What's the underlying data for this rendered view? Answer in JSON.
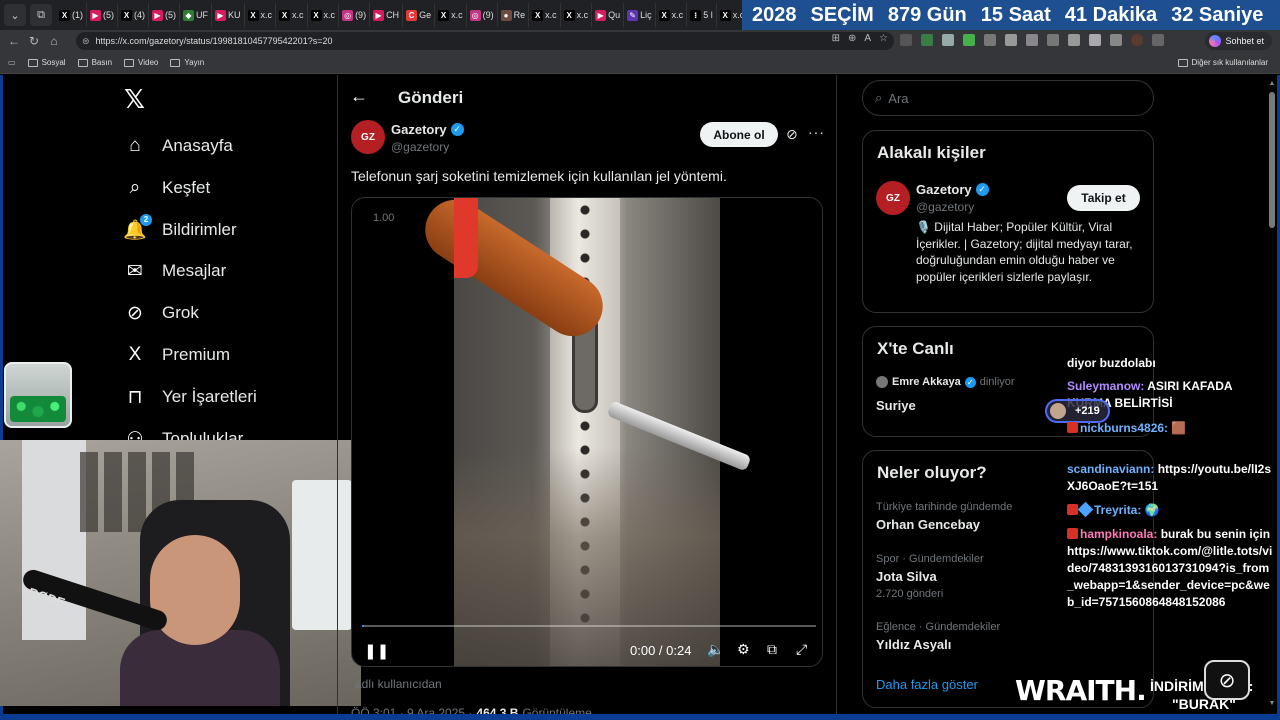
{
  "browser": {
    "tabs": [
      {
        "label": "(1)",
        "color": "#000000",
        "glyph": "X"
      },
      {
        "label": "(5)",
        "color": "#d81b60",
        "glyph": "▶"
      },
      {
        "label": "(4)",
        "color": "#000000",
        "glyph": "X"
      },
      {
        "label": "(5)",
        "color": "#d81b60",
        "glyph": "▶"
      },
      {
        "label": "UF",
        "color": "#2e7d32",
        "glyph": "◆"
      },
      {
        "label": "KU",
        "color": "#d81b60",
        "glyph": "▶"
      },
      {
        "label": "x.c",
        "color": "#000000",
        "glyph": "X"
      },
      {
        "label": "x.c",
        "color": "#000000",
        "glyph": "X"
      },
      {
        "label": "x.c",
        "color": "#000000",
        "glyph": "X"
      },
      {
        "label": "(9)",
        "color": "#c13584",
        "glyph": "◎"
      },
      {
        "label": "CH",
        "color": "#d81b60",
        "glyph": "▶"
      },
      {
        "label": "Ge",
        "color": "#e53935",
        "glyph": "C"
      },
      {
        "label": "x.c",
        "color": "#000000",
        "glyph": "X"
      },
      {
        "label": "(9)",
        "color": "#c13584",
        "glyph": "◎"
      },
      {
        "label": "Re",
        "color": "#6d4c41",
        "glyph": "●"
      },
      {
        "label": "x.c",
        "color": "#000000",
        "glyph": "X"
      },
      {
        "label": "x.c",
        "color": "#000000",
        "glyph": "X"
      },
      {
        "label": "Qu",
        "color": "#d81b60",
        "glyph": "▶"
      },
      {
        "label": "Liç",
        "color": "#5e35b1",
        "glyph": "✎"
      },
      {
        "label": "x.c",
        "color": "#000000",
        "glyph": "X"
      },
      {
        "label": "5 l",
        "color": "#000000",
        "glyph": "⁝"
      },
      {
        "label": "x.c",
        "color": "#000000",
        "glyph": "X"
      },
      {
        "label": "W",
        "color": "#1e88e5",
        "glyph": "∞"
      }
    ],
    "countdown": {
      "year": "2028",
      "label": "SEÇİM",
      "days": "879 Gün",
      "hours": "15 Saat",
      "minutes": "41 Dakika",
      "seconds": "32 Saniye"
    },
    "url": "https://x.com/gazetory/status/1998181045779542201?s=20",
    "chat_button": "Sohbet et",
    "bookmarks": [
      "Sosyal",
      "Basın",
      "Video",
      "Yayın"
    ],
    "bookmarks_other": "Diğer sık kullanılanlar"
  },
  "sidebar": {
    "items": [
      {
        "label": "Anasayfa",
        "icon": "home-icon",
        "glyph": "⌂"
      },
      {
        "label": "Keşfet",
        "icon": "search-icon",
        "glyph": "⌕"
      },
      {
        "label": "Bildirimler",
        "icon": "bell-icon",
        "glyph": "🔔",
        "badge": "2"
      },
      {
        "label": "Mesajlar",
        "icon": "mail-icon",
        "glyph": "✉"
      },
      {
        "label": "Grok",
        "icon": "grok-icon",
        "glyph": "⊘"
      },
      {
        "label": "Premium",
        "icon": "x-premium-icon",
        "glyph": "X"
      },
      {
        "label": "Yer İşaretleri",
        "icon": "bookmark-icon",
        "glyph": "⊓"
      },
      {
        "label": "Topluluklar",
        "icon": "communities-icon",
        "glyph": "⚇"
      }
    ]
  },
  "main": {
    "title": "Gönderi",
    "author": {
      "name": "Gazetory",
      "handle": "@gazetory",
      "avatar_text": "GZ"
    },
    "subscribe_label": "Abone ol",
    "tweet_text": "Telefonun şarj soketini temizlemek için kullanılan jel yöntemi.",
    "video": {
      "speed": "1.00",
      "time": "0:00 / 0:24",
      "progress": 0.005
    },
    "attribution": "adlı kullanıcıdan",
    "meta": {
      "time": "ÖÖ 3:01 · 9 Ara 2025 ·",
      "views": "464,3 B",
      "views_label": "Görüntüleme"
    }
  },
  "right": {
    "search_placeholder": "Ara",
    "related_title": "Alakalı kişiler",
    "related": {
      "name": "Gazetory",
      "handle": "@gazetory",
      "avatar_text": "GZ",
      "follow_label": "Takip et",
      "bio": "🎙️ Dijital Haber; Popüler Kültür, Viral İçerikler. | Gazetory; dijital medyayı tarar, doğruluğundan emin olduğu haber ve popüler içerikleri sizlerle paylaşır."
    },
    "live_title": "X'te Canlı",
    "live": {
      "host": "Emre Akkaya",
      "status": "dinliyor",
      "topic": "Suriye"
    },
    "trends_title": "Neler oluyor?",
    "trends": [
      {
        "context": "Türkiye tarihinde gündemde",
        "name": "Orhan Gencebay",
        "count": ""
      },
      {
        "context": "Spor · Gündemdekiler",
        "name": "Jota Silva",
        "count": "2.720 gönderi"
      },
      {
        "context": "Eğlence · Gündemdekiler",
        "name": "Yıldız Asyalı",
        "count": ""
      }
    ],
    "more_label": "Daha fazla göster"
  },
  "overlay": {
    "chat": [
      {
        "user": "",
        "text": "diyor buzdolabı"
      },
      {
        "user": "Suleymanow:",
        "text": " ASIRI KAFADA KURMA BELİRTİSİ"
      },
      {
        "user": "nickburns4826:",
        "text": " 🟫"
      },
      {
        "user": "scandinaviann:",
        "text": " https://youtu.be/lI2sXJ6OaoE?t=151"
      },
      {
        "user": "Treyrita:",
        "text": " 🌍"
      },
      {
        "user": "hampkinoala:",
        "text": " burak bu senin için https://www.tiktok.com/@litle.tots/video/7483139316013731094?is_from_webapp=1&sender_device=pc&web_id=7571560864848152086"
      }
    ],
    "viewers": "+219",
    "brand": "WRAITH.",
    "promo_line1": "İNDİRİM KODU:",
    "promo_line2": "\"BURAK\"",
    "mic_brand": "RØDE"
  }
}
